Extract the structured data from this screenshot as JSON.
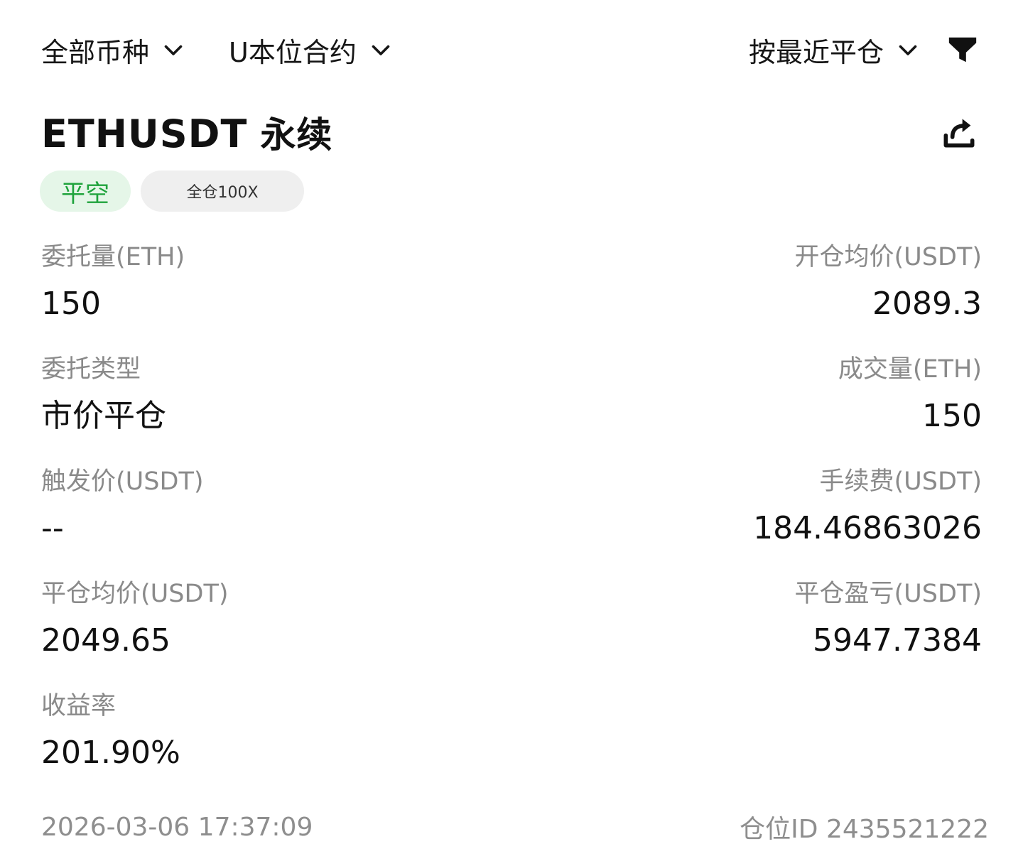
{
  "filters": {
    "coin": "全部币种",
    "contract": "U本位合约",
    "sort": "按最近平仓"
  },
  "header": {
    "symbol": "ETHUSDT",
    "perpetual": "永续"
  },
  "tags": {
    "direction": "平空",
    "leverage": "全仓100X"
  },
  "fields": {
    "order_qty_label": "委托量(ETH)",
    "order_qty": "150",
    "open_avg_label": "开仓均价(USDT)",
    "open_avg": "2089.3",
    "order_type_label": "委托类型",
    "order_type": "市价平仓",
    "filled_qty_label": "成交量(ETH)",
    "filled_qty": "150",
    "trigger_label": "触发价(USDT)",
    "trigger": "--",
    "fee_label": "手续费(USDT)",
    "fee": "184.46863026",
    "close_avg_label": "平仓均价(USDT)",
    "close_avg": "2049.65",
    "pnl_label": "平仓盈亏(USDT)",
    "pnl": "5947.7384",
    "roi_label": "收益率",
    "roi": "201.90%"
  },
  "footer": {
    "timestamp": "2026-03-06 17:37:09",
    "position_id": "仓位ID 2435521222"
  },
  "colors": {
    "accent_green": "#1fa33c",
    "tag_green_bg": "#e5f6e8",
    "label_gray": "#8a8a8a"
  },
  "icons": [
    "chevron-down-icon",
    "filter-funnel-icon",
    "share-icon"
  ]
}
